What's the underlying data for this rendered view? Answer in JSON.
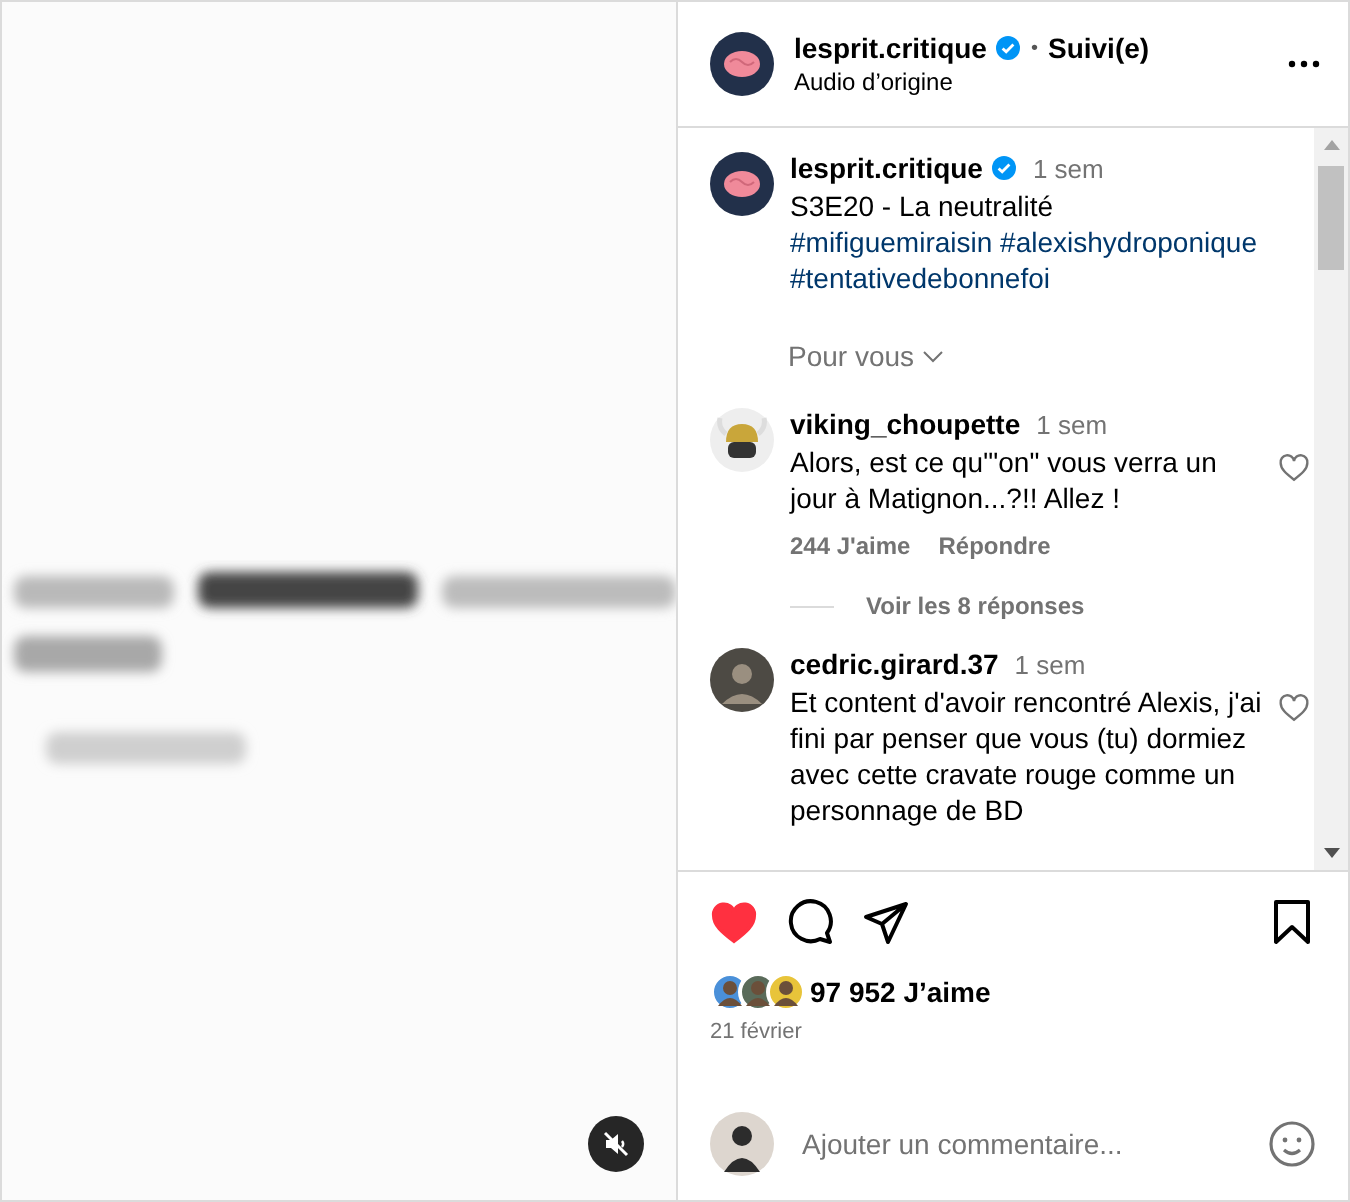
{
  "video": {
    "kind": "picture",
    "muted": true
  },
  "header": {
    "username": "lesprit.critique",
    "verified": true,
    "separator": "•",
    "follow_status": "Suivi(e)",
    "audio": "Audio d’origine"
  },
  "caption": {
    "username": "lesprit.critique",
    "verified": true,
    "time": "1 sem",
    "text": "S3E20 - La neutralité",
    "hashtags": [
      "#mifiguemiraisin",
      "#alexishydroponique",
      "#tentativedebonnefoi"
    ]
  },
  "sort": {
    "label": "Pour vous"
  },
  "comments": [
    {
      "kind": "helmet",
      "username": "viking_choupette",
      "time": "1 sem",
      "text": "Alors, est ce qu'\"on\" vous verra un jour à Matignon...?!! Allez !",
      "likes": "244 J'aime",
      "reply": "Répondre",
      "liked": false,
      "replies": "Voir les 8 réponses"
    },
    {
      "username": "cedric.girard.37",
      "time": "1 sem",
      "text": "Et content d'avoir rencontré Alexis, j'ai fini par penser que vous (tu) dormiez avec cette cravate rouge comme un personnage de BD",
      "liked": false
    }
  ],
  "actions": {
    "liked": true,
    "saved": false
  },
  "likes": {
    "count": "97 952 J’aime",
    "avatars": [
      {
        "color": "#4a90d9"
      },
      {
        "color": "#5a6b5a"
      },
      {
        "color": "#e8c43a"
      }
    ]
  },
  "date": "21 février",
  "comment_field": {
    "placeholder": "Ajouter un commentaire..."
  }
}
